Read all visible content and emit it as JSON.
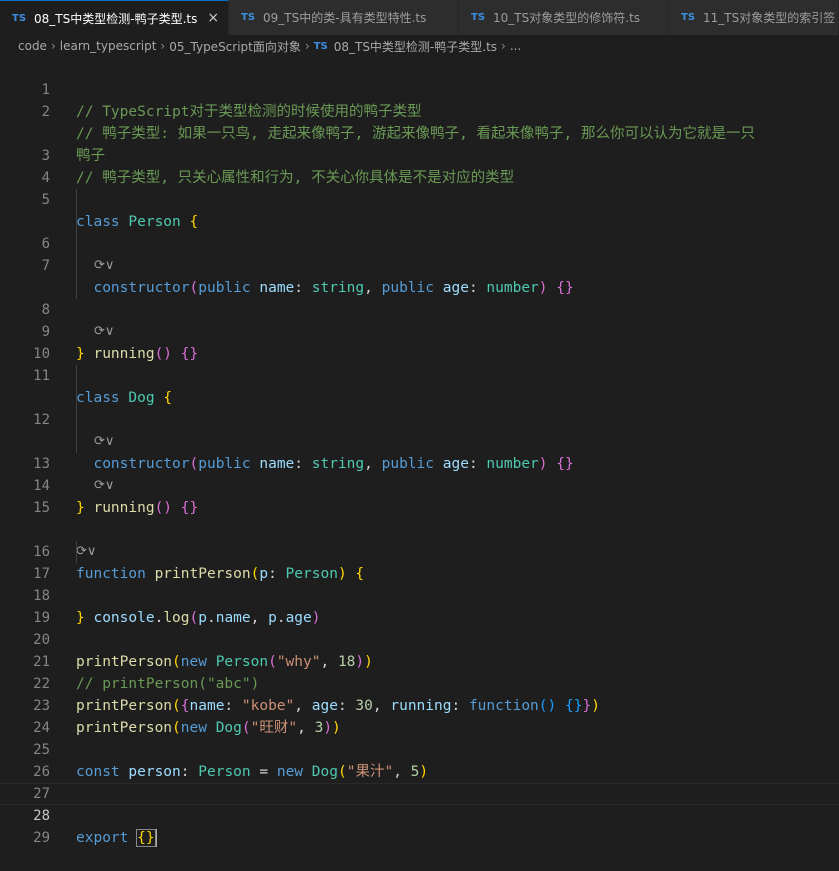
{
  "tabs": [
    {
      "icon": "TS",
      "label": "08_TS中类型检测-鸭子类型.ts",
      "active": true,
      "close": "×"
    },
    {
      "icon": "TS",
      "label": "09_TS中的类-具有类型特性.ts"
    },
    {
      "icon": "TS",
      "label": "10_TS对象类型的修饰符.ts"
    },
    {
      "icon": "TS",
      "label": "11_TS对象类型的索引签"
    }
  ],
  "breadcrumb": {
    "items": [
      "code",
      "learn_typescript",
      "05_TypeScript面向对象"
    ],
    "file_icon": "TS",
    "file": "08_TS中类型检测-鸭子类型.ts",
    "more": "..."
  },
  "code": {
    "line_numbers": [
      "1",
      "2",
      "",
      "3",
      "4",
      "5",
      "",
      "6",
      "7",
      "",
      "8",
      "9",
      "10",
      "11",
      "",
      "12",
      "",
      "13",
      "14",
      "15",
      "",
      "16",
      "17",
      "18",
      "19",
      "20",
      "21",
      "22",
      "23",
      "24",
      "25",
      "26",
      "27",
      "28",
      "29"
    ],
    "comment1": "// TypeScript对于类型检测的时候使用的鸭子类型",
    "comment2a": "// 鸭子类型: 如果一只鸟, 走起来像鸭子, 游起来像鸭子, 看起来像鸭子, 那么你可以认为它就是一只",
    "comment2b": "鸭子",
    "comment3": "// 鸭子类型, 只关心属性和行为, 不关心你具体是不是对应的类型",
    "kw_class": "class",
    "kw_public": "public",
    "kw_function": "function",
    "kw_new": "new",
    "kw_const": "const",
    "kw_export": "export",
    "type_person": "Person",
    "type_dog": "Dog",
    "type_string": "string",
    "type_number": "number",
    "fn_constructor": "constructor",
    "fn_running": "running",
    "fn_printPerson": "printPerson",
    "fn_log": "log",
    "var_name": "name",
    "var_age": "age",
    "var_p": "p",
    "var_console": "console",
    "var_person": "person",
    "prop_running": "running",
    "str_why": "\"why\"",
    "num_18": "18",
    "comment21": "// printPerson(\"abc\")",
    "str_kobe": "\"kobe\"",
    "num_30": "30",
    "str_wangcai": "\"旺财\"",
    "num_3": "3",
    "str_guozhi": "\"果汁\"",
    "num_5": "5",
    "lens_icon": "⟳∨"
  }
}
